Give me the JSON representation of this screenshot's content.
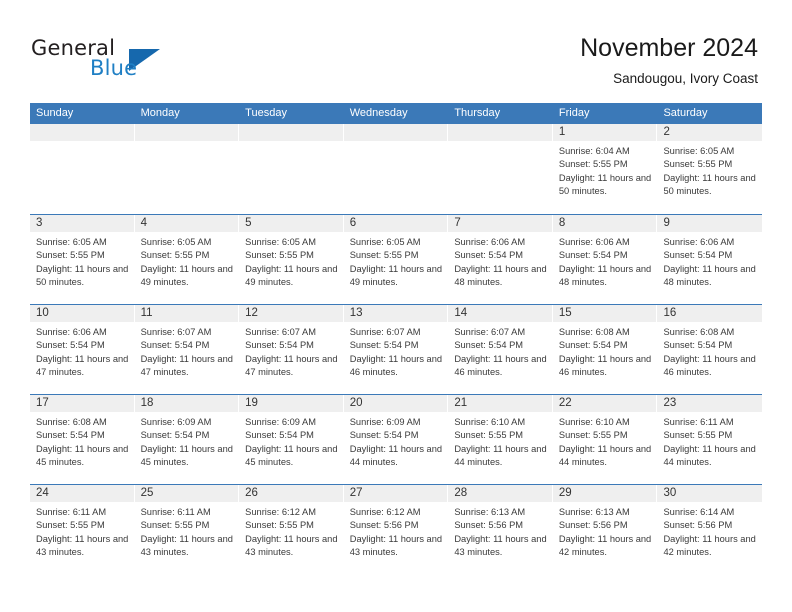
{
  "brand": {
    "name_top": "General",
    "name_bottom": "Blue",
    "triangle_color": "#1668ad",
    "blue_color": "#1f7fc4"
  },
  "header": {
    "title": "November 2024",
    "subtitle": "Sandougou, Ivory Coast",
    "accent_color": "#3b79b8",
    "numbar_color": "#efefef"
  },
  "weekday_headers": [
    "Sunday",
    "Monday",
    "Tuesday",
    "Wednesday",
    "Thursday",
    "Friday",
    "Saturday"
  ],
  "labels": {
    "sunrise": "Sunrise:",
    "sunset": "Sunset:",
    "daylight": "Daylight:"
  },
  "weeks": [
    [
      {
        "day": "",
        "empty": true
      },
      {
        "day": "",
        "empty": true
      },
      {
        "day": "",
        "empty": true
      },
      {
        "day": "",
        "empty": true
      },
      {
        "day": "",
        "empty": true
      },
      {
        "day": "1",
        "sunrise": "Sunrise: 6:04 AM",
        "sunset": "Sunset: 5:55 PM",
        "daylight": "Daylight: 11 hours and 50 minutes."
      },
      {
        "day": "2",
        "sunrise": "Sunrise: 6:05 AM",
        "sunset": "Sunset: 5:55 PM",
        "daylight": "Daylight: 11 hours and 50 minutes."
      }
    ],
    [
      {
        "day": "3",
        "sunrise": "Sunrise: 6:05 AM",
        "sunset": "Sunset: 5:55 PM",
        "daylight": "Daylight: 11 hours and 50 minutes."
      },
      {
        "day": "4",
        "sunrise": "Sunrise: 6:05 AM",
        "sunset": "Sunset: 5:55 PM",
        "daylight": "Daylight: 11 hours and 49 minutes."
      },
      {
        "day": "5",
        "sunrise": "Sunrise: 6:05 AM",
        "sunset": "Sunset: 5:55 PM",
        "daylight": "Daylight: 11 hours and 49 minutes."
      },
      {
        "day": "6",
        "sunrise": "Sunrise: 6:05 AM",
        "sunset": "Sunset: 5:55 PM",
        "daylight": "Daylight: 11 hours and 49 minutes."
      },
      {
        "day": "7",
        "sunrise": "Sunrise: 6:06 AM",
        "sunset": "Sunset: 5:54 PM",
        "daylight": "Daylight: 11 hours and 48 minutes."
      },
      {
        "day": "8",
        "sunrise": "Sunrise: 6:06 AM",
        "sunset": "Sunset: 5:54 PM",
        "daylight": "Daylight: 11 hours and 48 minutes."
      },
      {
        "day": "9",
        "sunrise": "Sunrise: 6:06 AM",
        "sunset": "Sunset: 5:54 PM",
        "daylight": "Daylight: 11 hours and 48 minutes."
      }
    ],
    [
      {
        "day": "10",
        "sunrise": "Sunrise: 6:06 AM",
        "sunset": "Sunset: 5:54 PM",
        "daylight": "Daylight: 11 hours and 47 minutes."
      },
      {
        "day": "11",
        "sunrise": "Sunrise: 6:07 AM",
        "sunset": "Sunset: 5:54 PM",
        "daylight": "Daylight: 11 hours and 47 minutes."
      },
      {
        "day": "12",
        "sunrise": "Sunrise: 6:07 AM",
        "sunset": "Sunset: 5:54 PM",
        "daylight": "Daylight: 11 hours and 47 minutes."
      },
      {
        "day": "13",
        "sunrise": "Sunrise: 6:07 AM",
        "sunset": "Sunset: 5:54 PM",
        "daylight": "Daylight: 11 hours and 46 minutes."
      },
      {
        "day": "14",
        "sunrise": "Sunrise: 6:07 AM",
        "sunset": "Sunset: 5:54 PM",
        "daylight": "Daylight: 11 hours and 46 minutes."
      },
      {
        "day": "15",
        "sunrise": "Sunrise: 6:08 AM",
        "sunset": "Sunset: 5:54 PM",
        "daylight": "Daylight: 11 hours and 46 minutes."
      },
      {
        "day": "16",
        "sunrise": "Sunrise: 6:08 AM",
        "sunset": "Sunset: 5:54 PM",
        "daylight": "Daylight: 11 hours and 46 minutes."
      }
    ],
    [
      {
        "day": "17",
        "sunrise": "Sunrise: 6:08 AM",
        "sunset": "Sunset: 5:54 PM",
        "daylight": "Daylight: 11 hours and 45 minutes."
      },
      {
        "day": "18",
        "sunrise": "Sunrise: 6:09 AM",
        "sunset": "Sunset: 5:54 PM",
        "daylight": "Daylight: 11 hours and 45 minutes."
      },
      {
        "day": "19",
        "sunrise": "Sunrise: 6:09 AM",
        "sunset": "Sunset: 5:54 PM",
        "daylight": "Daylight: 11 hours and 45 minutes."
      },
      {
        "day": "20",
        "sunrise": "Sunrise: 6:09 AM",
        "sunset": "Sunset: 5:54 PM",
        "daylight": "Daylight: 11 hours and 44 minutes."
      },
      {
        "day": "21",
        "sunrise": "Sunrise: 6:10 AM",
        "sunset": "Sunset: 5:55 PM",
        "daylight": "Daylight: 11 hours and 44 minutes."
      },
      {
        "day": "22",
        "sunrise": "Sunrise: 6:10 AM",
        "sunset": "Sunset: 5:55 PM",
        "daylight": "Daylight: 11 hours and 44 minutes."
      },
      {
        "day": "23",
        "sunrise": "Sunrise: 6:11 AM",
        "sunset": "Sunset: 5:55 PM",
        "daylight": "Daylight: 11 hours and 44 minutes."
      }
    ],
    [
      {
        "day": "24",
        "sunrise": "Sunrise: 6:11 AM",
        "sunset": "Sunset: 5:55 PM",
        "daylight": "Daylight: 11 hours and 43 minutes."
      },
      {
        "day": "25",
        "sunrise": "Sunrise: 6:11 AM",
        "sunset": "Sunset: 5:55 PM",
        "daylight": "Daylight: 11 hours and 43 minutes."
      },
      {
        "day": "26",
        "sunrise": "Sunrise: 6:12 AM",
        "sunset": "Sunset: 5:55 PM",
        "daylight": "Daylight: 11 hours and 43 minutes."
      },
      {
        "day": "27",
        "sunrise": "Sunrise: 6:12 AM",
        "sunset": "Sunset: 5:56 PM",
        "daylight": "Daylight: 11 hours and 43 minutes."
      },
      {
        "day": "28",
        "sunrise": "Sunrise: 6:13 AM",
        "sunset": "Sunset: 5:56 PM",
        "daylight": "Daylight: 11 hours and 43 minutes."
      },
      {
        "day": "29",
        "sunrise": "Sunrise: 6:13 AM",
        "sunset": "Sunset: 5:56 PM",
        "daylight": "Daylight: 11 hours and 42 minutes."
      },
      {
        "day": "30",
        "sunrise": "Sunrise: 6:14 AM",
        "sunset": "Sunset: 5:56 PM",
        "daylight": "Daylight: 11 hours and 42 minutes."
      }
    ]
  ]
}
